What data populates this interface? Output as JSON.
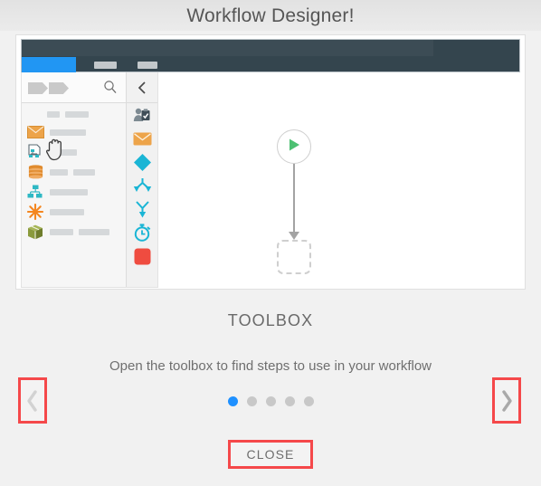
{
  "dialog": {
    "title": "Workflow Designer!",
    "caption_title": "TOOLBOX",
    "caption_text": "Open the toolbox to find steps to use in your workflow",
    "close_label": "CLOSE",
    "prev_label": "‹",
    "next_label": "›"
  },
  "colors": {
    "header_bg": "#e7e7e7",
    "body_bg": "#f1f1f1",
    "toolbar_dark": "#34454e",
    "toolbar_band": "#3c4c55",
    "active_tab_blue": "#2196f3",
    "dot_active": "#1e90ff",
    "dot_inactive": "#c8c8c8",
    "annotation_red": "#f5484a",
    "start_node_green": "#4cc072",
    "icon_orange": "#eda44a",
    "icon_teal": "#2eb8c4",
    "icon_cyan": "#1ab5d5",
    "icon_olive": "#8a9a3c",
    "icon_red": "#ef4c40",
    "text_gray": "#6a6a6a",
    "connector_gray": "#a3a3a3",
    "placeholder_gray": "#d5d8da"
  },
  "illustration": {
    "toolbar": {
      "active_tab_name": "active-tab",
      "ghost_tabs": [
        "tab-placeholder-1",
        "tab-placeholder-2"
      ]
    },
    "search_bar": {
      "breadcrumb_icon": "breadcrumb-chevrons-icon",
      "search_icon": "search-icon",
      "collapse_icon": "chevron-left-icon"
    },
    "list_header_bars": [
      14,
      26
    ],
    "list_items": [
      {
        "icon": "envelope-icon",
        "color": "#eda44a",
        "bars": [
          40
        ]
      },
      {
        "icon": "document-flowchart-icon",
        "color": "#5a6a72",
        "bars": [
          30
        ]
      },
      {
        "icon": "database-stack-icon",
        "color": "#e08b2e",
        "bars": [
          20,
          24
        ]
      },
      {
        "icon": "org-chart-icon",
        "color": "#2eb8c4",
        "bars": [
          42
        ]
      },
      {
        "icon": "asterisk-burst-icon",
        "color": "#f4861f",
        "bars": [
          38
        ]
      },
      {
        "icon": "cube-box-icon",
        "color": "#8a9a3c",
        "bars": [
          26,
          34
        ]
      }
    ],
    "strip_icons": [
      {
        "name": "user-task-icon",
        "color": "#4c5a63"
      },
      {
        "name": "envelope-icon",
        "color": "#eda44a"
      },
      {
        "name": "decision-diamond-icon",
        "color": "#1ab5d5"
      },
      {
        "name": "split-branch-icon",
        "color": "#1ab5d5"
      },
      {
        "name": "merge-branch-icon",
        "color": "#1ab5d5"
      },
      {
        "name": "timer-stopwatch-icon",
        "color": "#1ab5d5"
      },
      {
        "name": "terminate-square-icon",
        "color": "#ef4c40"
      }
    ],
    "canvas": {
      "start_node_icon": "play-start-icon",
      "connector": "connector-arrow",
      "drop_target": "dashed-drop-target",
      "cursor": "grab-hand-cursor"
    }
  },
  "pagination": {
    "total": 5,
    "active_index": 0,
    "dots": [
      "page-dot-1",
      "page-dot-2",
      "page-dot-3",
      "page-dot-4",
      "page-dot-5"
    ]
  }
}
